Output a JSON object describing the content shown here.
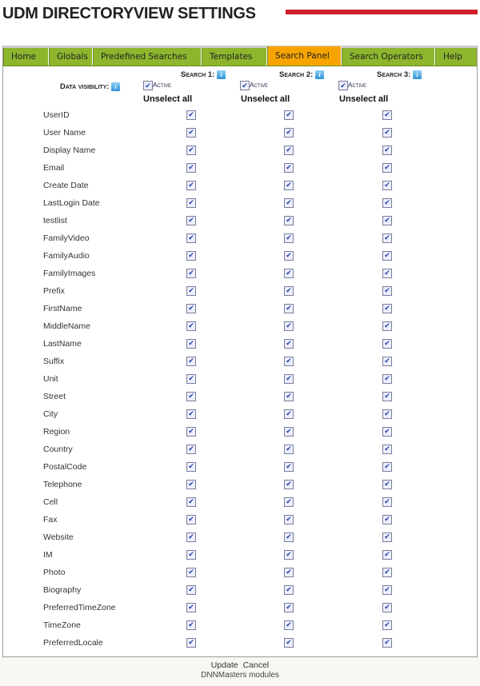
{
  "header": {
    "title": "UDM DIRECTORYVIEW SETTINGS",
    "accent": "#d0202a"
  },
  "tabs": [
    {
      "label": "Home"
    },
    {
      "label": "Globals"
    },
    {
      "label": "Predefined Searches"
    },
    {
      "label": "Templates"
    },
    {
      "label": "Search Panel",
      "active": true
    },
    {
      "label": "Search Operators"
    },
    {
      "label": "Help"
    }
  ],
  "panel": {
    "data_visibility": "Data visibility:",
    "searches": [
      {
        "label": "Search 1:",
        "active_label": "Active",
        "active": true,
        "unselect": "Unselect all"
      },
      {
        "label": "Search 2:",
        "active_label": "Active",
        "active": true,
        "unselect": "Unselect all"
      },
      {
        "label": "Search 3:",
        "active_label": "Active",
        "active": true,
        "unselect": "Unselect all"
      }
    ],
    "fields": [
      "UserID",
      "User Name",
      "Display Name",
      "Email",
      "Create Date",
      "LastLogin Date",
      "testlist",
      "FamilyVideo",
      "FamilyAudio",
      "FamilyImages",
      "Prefix",
      "FirstName",
      "MiddleName",
      "LastName",
      "Suffix",
      "Unit",
      "Street",
      "City",
      "Region",
      "Country",
      "PostalCode",
      "Telephone",
      "Cell",
      "Fax",
      "Website",
      "IM",
      "Photo",
      "Biography",
      "PreferredTimeZone",
      "TimeZone",
      "PreferredLocale"
    ],
    "all_checked": true
  },
  "footer": {
    "update": "Update",
    "cancel": "Cancel",
    "credit": "DNNMasters modules"
  }
}
